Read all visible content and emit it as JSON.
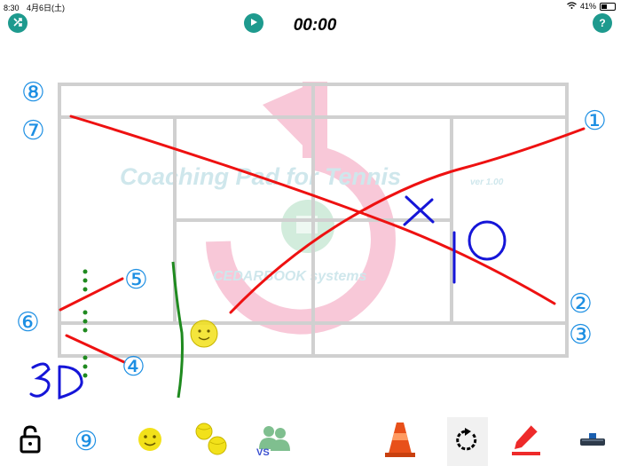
{
  "status_bar": {
    "time": "8:30",
    "date": "4月6日(土)",
    "battery": "41%"
  },
  "header": {
    "timer": "00:00"
  },
  "watermark": {
    "title": "Coaching Pad for Tennis",
    "version": "ver 1.00",
    "company": "CEDARBOOK systems"
  },
  "markers": [
    {
      "id": "8",
      "label": "⑧"
    },
    {
      "id": "7",
      "label": "⑦"
    },
    {
      "id": "6",
      "label": "⑥"
    },
    {
      "id": "5",
      "label": "⑤"
    },
    {
      "id": "4",
      "label": "④"
    },
    {
      "id": "1",
      "label": "①"
    },
    {
      "id": "2",
      "label": "②"
    },
    {
      "id": "3",
      "label": "③"
    }
  ],
  "toolbar": {
    "number_tool_label": "⑨",
    "vs_label": "VS"
  },
  "colors": {
    "accent": "#1e9a8e",
    "court_line": "#d0d0d0",
    "marker": "#1d8fe3",
    "pen_red": "#ee1111",
    "pen_blue": "#1515d8",
    "pen_green": "#1f8a1f",
    "ball_yellow": "#f2e11a",
    "watermark_pink": "#f8c8d8"
  },
  "icons": [
    "shuffle-icon",
    "play-icon",
    "help-icon",
    "lock-icon",
    "face-icon",
    "balls-icon",
    "players-vs-icon",
    "cone-icon",
    "undo-icon",
    "pen-icon",
    "eraser-icon"
  ]
}
